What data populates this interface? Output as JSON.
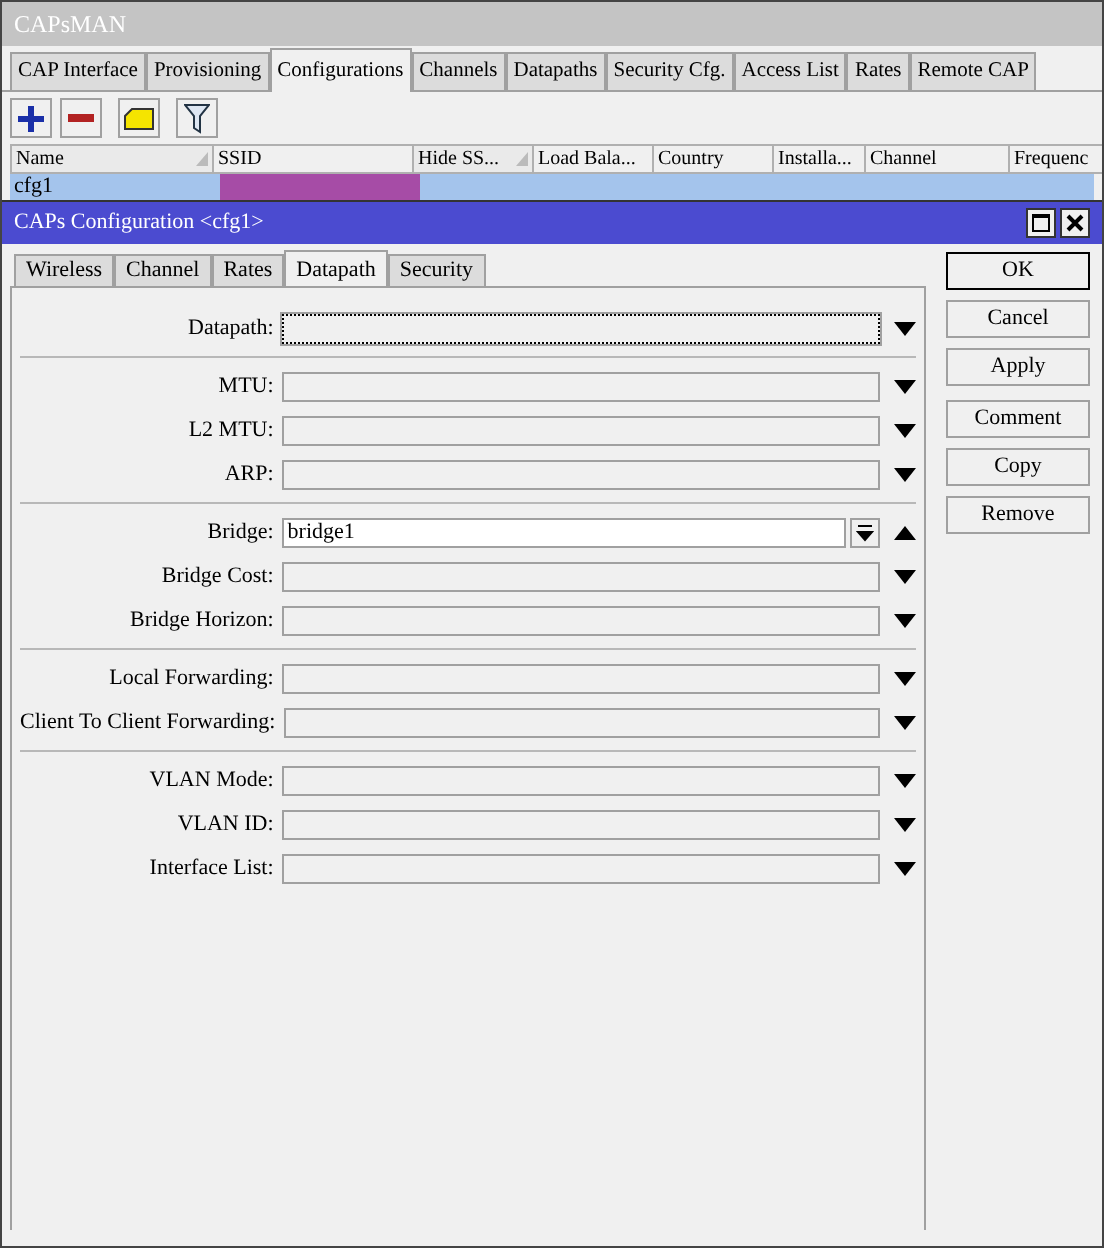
{
  "window": {
    "title": "CAPsMAN"
  },
  "tabs": [
    {
      "label": "CAP Interface",
      "selected": false
    },
    {
      "label": "Provisioning",
      "selected": false
    },
    {
      "label": "Configurations",
      "selected": true
    },
    {
      "label": "Channels",
      "selected": false
    },
    {
      "label": "Datapaths",
      "selected": false
    },
    {
      "label": "Security Cfg.",
      "selected": false
    },
    {
      "label": "Access List",
      "selected": false
    },
    {
      "label": "Rates",
      "selected": false
    },
    {
      "label": "Remote CAP",
      "selected": false
    }
  ],
  "table": {
    "columns": [
      {
        "label": "Name",
        "sorted": true
      },
      {
        "label": "SSID",
        "sorted": false
      },
      {
        "label": "Hide SS...",
        "sorted": true
      },
      {
        "label": "Load Bala...",
        "sorted": false
      },
      {
        "label": "Country",
        "sorted": false
      },
      {
        "label": "Installa...",
        "sorted": false
      },
      {
        "label": "Channel",
        "sorted": false
      },
      {
        "label": "Frequenc",
        "sorted": false
      }
    ],
    "rows": [
      {
        "name": "cfg1",
        "selected": true
      }
    ]
  },
  "dialog": {
    "title": "CAPs Configuration <cfg1>",
    "tabs": [
      {
        "label": "Wireless",
        "selected": false
      },
      {
        "label": "Channel",
        "selected": false
      },
      {
        "label": "Rates",
        "selected": false
      },
      {
        "label": "Datapath",
        "selected": true
      },
      {
        "label": "Security",
        "selected": false
      }
    ],
    "groups": [
      [
        {
          "label": "Datapath:",
          "kind": "optional",
          "focused": true
        }
      ],
      [
        {
          "label": "MTU:",
          "kind": "optional",
          "focused": false
        },
        {
          "label": "L2 MTU:",
          "kind": "optional",
          "focused": false
        },
        {
          "label": "ARP:",
          "kind": "optional",
          "focused": false
        }
      ],
      [
        {
          "label": "Bridge:",
          "kind": "list",
          "value": "bridge1",
          "focused": false
        },
        {
          "label": "Bridge Cost:",
          "kind": "optional",
          "focused": false
        },
        {
          "label": "Bridge Horizon:",
          "kind": "optional",
          "focused": false
        }
      ],
      [
        {
          "label": "Local Forwarding:",
          "kind": "optional",
          "focused": false
        },
        {
          "label": "Client To Client Forwarding:",
          "kind": "optional",
          "focused": false
        }
      ],
      [
        {
          "label": "VLAN Mode:",
          "kind": "optional",
          "focused": false
        },
        {
          "label": "VLAN ID:",
          "kind": "optional",
          "focused": false
        },
        {
          "label": "Interface List:",
          "kind": "optional",
          "focused": false
        }
      ]
    ],
    "buttons": [
      [
        {
          "label": "OK",
          "default": true
        },
        {
          "label": "Cancel",
          "default": false
        },
        {
          "label": "Apply",
          "default": false
        }
      ],
      [
        {
          "label": "Comment",
          "default": false
        },
        {
          "label": "Copy",
          "default": false
        },
        {
          "label": "Remove",
          "default": false
        }
      ]
    ]
  }
}
